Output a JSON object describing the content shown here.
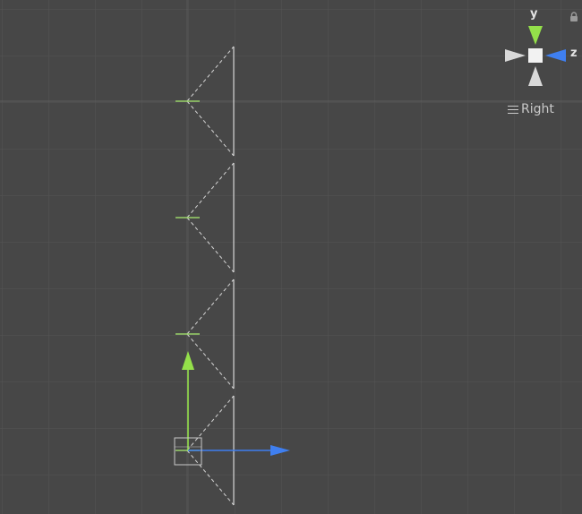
{
  "scene": {
    "background_color": "#474747",
    "grid_color": "#5a5a5a",
    "grid_major_color": "#707070"
  },
  "orientation_gizmo": {
    "y_label": "y",
    "z_label": "z",
    "view_label": "Right",
    "y_color": "#94e04a",
    "z_color": "#3f7ff0",
    "neutral_color": "#d9d9d9"
  },
  "transform_handle": {
    "up_axis_color": "#94e04a",
    "forward_axis_color": "#3f7ff0"
  },
  "cameras": {
    "frustum_color": "#d6d6d6",
    "count": 4
  },
  "icons": {
    "lock": "lock-icon",
    "menu": "hamburger-menu-icon"
  }
}
